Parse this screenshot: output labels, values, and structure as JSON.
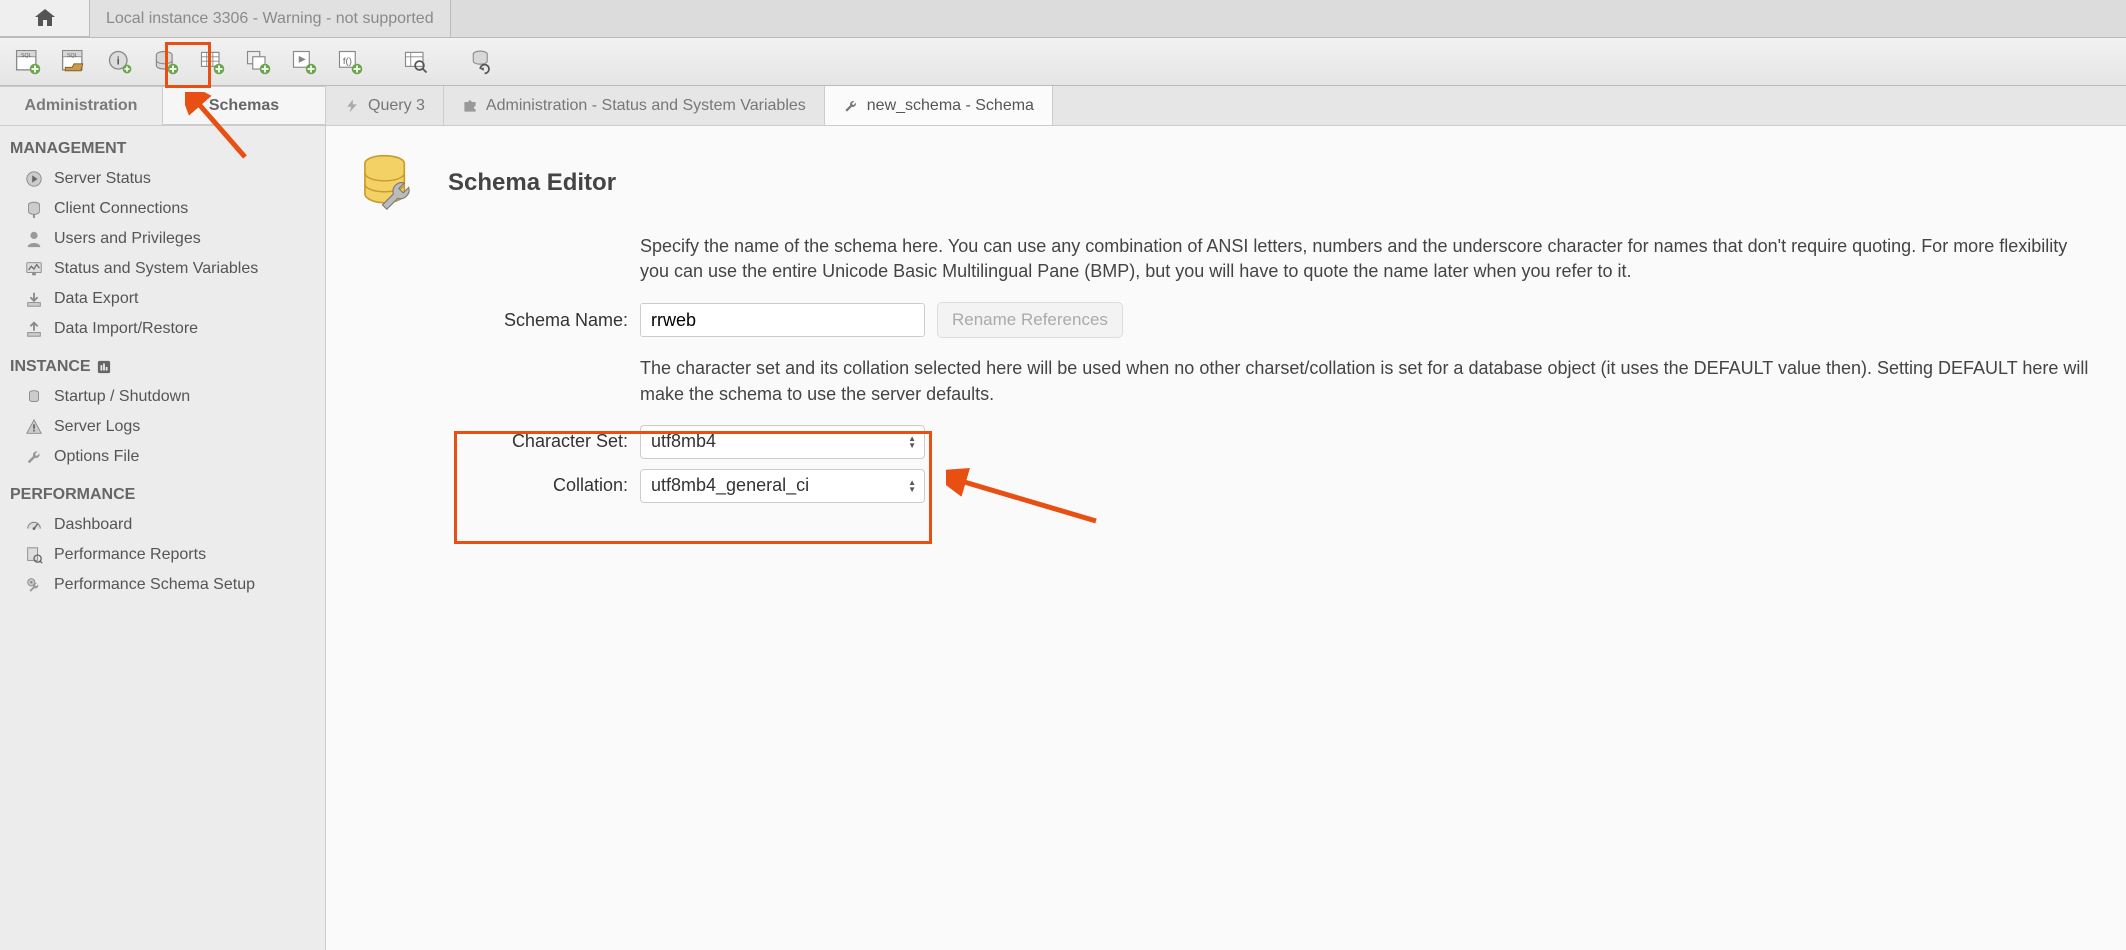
{
  "topTabs": {
    "connection": "Local instance 3306 - Warning - not supported"
  },
  "sidebar": {
    "tabs": {
      "admin": "Administration",
      "schemas": "Schemas"
    },
    "sections": {
      "management": {
        "title": "MANAGEMENT",
        "items": [
          "Server Status",
          "Client Connections",
          "Users and Privileges",
          "Status and System Variables",
          "Data Export",
          "Data Import/Restore"
        ]
      },
      "instance": {
        "title": "INSTANCE",
        "items": [
          "Startup / Shutdown",
          "Server Logs",
          "Options File"
        ]
      },
      "performance": {
        "title": "PERFORMANCE",
        "items": [
          "Dashboard",
          "Performance Reports",
          "Performance Schema Setup"
        ]
      }
    }
  },
  "mainTabs": {
    "t0": "Query 3",
    "t1": "Administration - Status and System Variables",
    "t2": "new_schema - Schema"
  },
  "editor": {
    "title": "Schema Editor",
    "help1": "Specify the name of the schema here. You can use any combination of ANSI letters, numbers and the underscore character for names that don't require quoting. For more flexibility you can use the entire Unicode Basic Multilingual Pane (BMP), but you will have to quote the name later when you refer to it.",
    "help2": "The character set and its collation selected here will be used when no other charset/collation is set for a database object (it uses the DEFAULT value then). Setting DEFAULT here will make the schema to use the server defaults.",
    "schemaNameLabel": "Schema Name:",
    "schemaNameValue": "rrweb",
    "renameBtn": "Rename References",
    "charsetLabel": "Character Set:",
    "charsetValue": "utf8mb4",
    "collationLabel": "Collation:",
    "collationValue": "utf8mb4_general_ci"
  }
}
